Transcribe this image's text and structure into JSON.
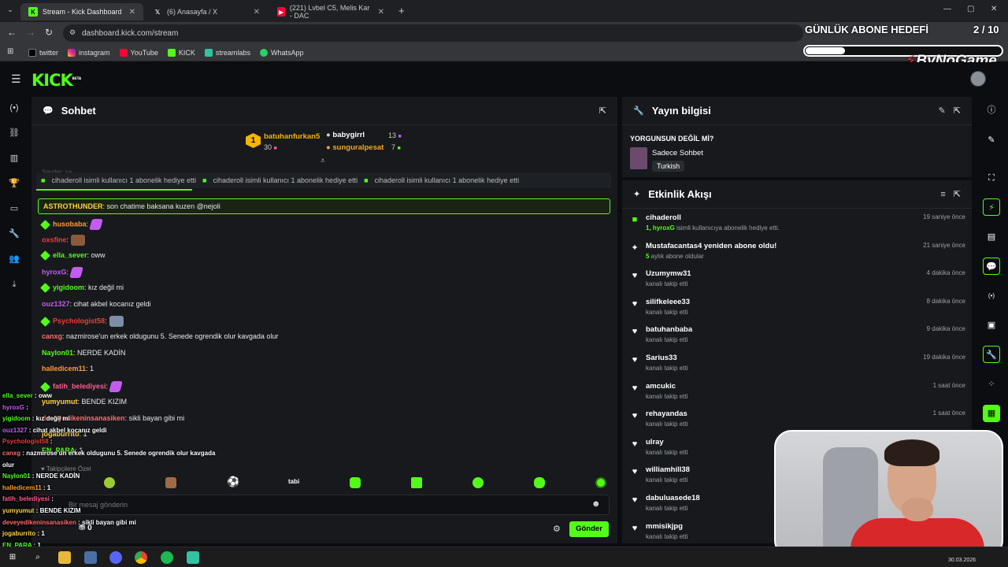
{
  "browser": {
    "tabs": [
      {
        "title": "Stream - Kick Dashboard"
      },
      {
        "title": "(6) Anasayfa / X"
      },
      {
        "title": "(221) Lvbel C5, Melis Kar - DAC"
      }
    ],
    "url": "dashboard.kick.com/stream",
    "bookmarks": [
      "twitter",
      "instagram",
      "YouTube",
      "KICK",
      "streamlabs",
      "WhatsApp"
    ]
  },
  "overlay": {
    "goal_title": "GÜNLÜK ABONE HEDEFİ",
    "goal_count": "2 / 10",
    "goal_progress": 0.2,
    "brand": "ByNoGame"
  },
  "kick": {
    "logo": "KICK",
    "logo_tag": "BETA"
  },
  "chat": {
    "title": "Sohbet",
    "leaderboard": [
      {
        "rank": "1",
        "name": "batuhanfurkan5",
        "count": "30"
      },
      {
        "name": "babygirrl",
        "count": "13"
      },
      {
        "name": "sunguralpesat",
        "count": "7"
      }
    ],
    "gift_banner": "cihaderoll isimli kullanıcı 1 abonelik hediye etti",
    "faded_top": "Seyder: şa",
    "faded_top2": "cihaderoll isimli kullanıcı 1 abonelik hediye etti",
    "highlight": {
      "user": "ASTROTHUNDER",
      "text": ": son chatime baksana kuzen @nejoli"
    },
    "messages": [
      {
        "user": "husobaba",
        "text": ":",
        "color": "#ff9b2e"
      },
      {
        "user": "oxsfine",
        "text": ":",
        "color": "#e8403a"
      },
      {
        "user": "ella_sever",
        "text": ": oww",
        "color": "#53fc18"
      },
      {
        "user": "hyroxG",
        "text": ":",
        "color": "#c45cf0"
      },
      {
        "user": "yigidoom",
        "text": ": kız değil mi",
        "color": "#53fc18"
      },
      {
        "user": "ouz1327",
        "text": ": cihat akbel kocanız geldi",
        "color": "#c45cf0"
      },
      {
        "user": "Psychologist58",
        "text": ":",
        "color": "#e8403a"
      },
      {
        "user": "canxg",
        "text": ": nazmirose'un erkek oldugunu 5. Senede ogrendik olur kavgada olur",
        "color": "#ff6b6b"
      },
      {
        "user": "Naylon01",
        "text": ": NERDE KADİN",
        "color": "#53fc18"
      },
      {
        "user": "halledicem11",
        "text": ": 1",
        "color": "#ff9b2e"
      },
      {
        "user": "fatih_belediyesi",
        "text": ":",
        "color": "#ff5d8f"
      },
      {
        "user": "yumyumut",
        "text": ": BENDE KIZIM",
        "color": "#ffd23f"
      },
      {
        "user": "deveyedikeninsanasiken",
        "text": ": sikli bayan gibi mi",
        "color": "#ff6b6b"
      },
      {
        "user": "jogaburrito",
        "text": ": 1",
        "color": "#ffd23f"
      },
      {
        "user": "EN_PARA",
        "text": ": 1",
        "color": "#53fc18"
      }
    ],
    "followers_only": "Takipçilere Özel",
    "emote_tabi": "tabi",
    "input_placeholder": "Bir mesaj gönderin",
    "points": "0",
    "send_label": "Gönder"
  },
  "stream_info": {
    "title": "Yayın bilgisi",
    "stream_title": "YORGUNSUN DEĞİL Mİ?",
    "category": "Sadece Sohbet",
    "language": "Turkish"
  },
  "activity": {
    "title": "Etkinlik Akışı",
    "events": [
      {
        "name": "cihaderoll",
        "sub_user": "1, hyroxG",
        "sub": " isimli kullanıcıya abonelik hediye etti.",
        "time": "19 saniye önce",
        "icon": "gift"
      },
      {
        "name": "Mustafacantas4 yeniden abone oldu!",
        "sub_user": "5",
        "sub": " aylık abone oldular",
        "time": "21 saniye önce",
        "icon": "star"
      },
      {
        "name": "Uzumymw31",
        "sub_user": "",
        "sub": "kanalı takip etti",
        "time": "4 dakika önce",
        "icon": "heart"
      },
      {
        "name": "silifkeleee33",
        "sub_user": "",
        "sub": "kanalı takip etti",
        "time": "8 dakika önce",
        "icon": "heart"
      },
      {
        "name": "batuhanbaba",
        "sub_user": "",
        "sub": "kanalı takip etti",
        "time": "9 dakika önce",
        "icon": "heart"
      },
      {
        "name": "Sarius33",
        "sub_user": "",
        "sub": "kanalı takip etti",
        "time": "19 dakika önce",
        "icon": "heart"
      },
      {
        "name": "amcukic",
        "sub_user": "",
        "sub": "kanalı takip etti",
        "time": "1 saat önce",
        "icon": "heart"
      },
      {
        "name": "rehayandas",
        "sub_user": "",
        "sub": "kanalı takip etti",
        "time": "1 saat önce",
        "icon": "heart"
      },
      {
        "name": "ulray",
        "sub_user": "",
        "sub": "kanalı takip etti",
        "time": "",
        "icon": "heart"
      },
      {
        "name": "williamhill38",
        "sub_user": "",
        "sub": "kanalı takip etti",
        "time": "",
        "icon": "heart"
      },
      {
        "name": "dabuluasede18",
        "sub_user": "",
        "sub": "kanalı takip etti",
        "time": "",
        "icon": "heart"
      },
      {
        "name": "mmisikjpg",
        "sub_user": "",
        "sub": "kanalı takip etti",
        "time": "",
        "icon": "heart"
      }
    ]
  },
  "stream_overlay_chat": [
    {
      "user": "ella_sever",
      "text": " : oww",
      "color": "#53fc18"
    },
    {
      "user": "hyroxG",
      "text": " :",
      "color": "#c45cf0"
    },
    {
      "user": "yigidoom",
      "text": " : kız değil mi",
      "color": "#53fc18"
    },
    {
      "user": "ouz1327",
      "text": " : cihat akbel kocanız geldi",
      "color": "#c45cf0"
    },
    {
      "user": "Psychologist58",
      "text": " :",
      "color": "#e8403a"
    },
    {
      "user": "canxg",
      "text": " : nazmirose'un erkek oldugunu 5. Senede ogrendik olur kavgada",
      "color": "#ff6b6b"
    },
    {
      "user": "",
      "text": "olur",
      "color": "#fff"
    },
    {
      "user": "Naylon01",
      "text": " : NERDE KADİN",
      "color": "#53fc18"
    },
    {
      "user": "halledicem11",
      "text": " : 1",
      "color": "#ff9b2e"
    },
    {
      "user": "fatih_belediyesi",
      "text": " :",
      "color": "#ff5d8f"
    },
    {
      "user": "yumyumut",
      "text": " : BENDE KIZIM",
      "color": "#ffd23f"
    },
    {
      "user": "deveyedikeninsanasiken",
      "text": " : sikli bayan gibi mi",
      "color": "#ff6b6b"
    },
    {
      "user": "jogaburrito",
      "text": " : 1",
      "color": "#ffd23f"
    },
    {
      "user": "EN_PARA",
      "text": " : 1",
      "color": "#53fc18"
    }
  ],
  "taskbar": {
    "date": "30.03.2026"
  },
  "colors": {
    "accent": "#53fc18",
    "panel": "#17191c",
    "background": "#0b0d10"
  }
}
